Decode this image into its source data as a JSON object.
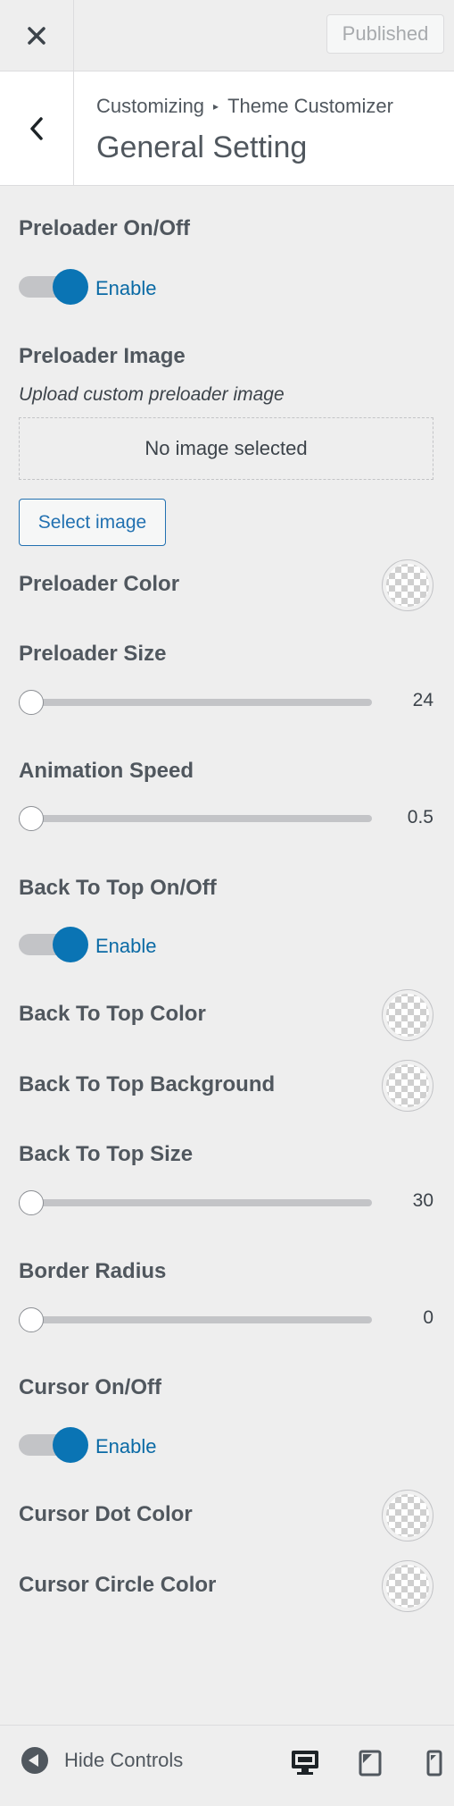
{
  "topbar": {
    "close_icon": "close-icon",
    "publish_label": "Published"
  },
  "header": {
    "breadcrumb_root": "Customizing",
    "breadcrumb_separator": "▸",
    "breadcrumb_leaf": "Theme Customizer",
    "title": "General Setting"
  },
  "preloader_toggle": {
    "label": "Preloader On/Off",
    "state_label": "Enable",
    "enabled": true
  },
  "preloader_image": {
    "label": "Preloader Image",
    "description": "Upload custom preloader image",
    "empty_text": "No image selected",
    "select_label": "Select image"
  },
  "preloader_color": {
    "label": "Preloader Color"
  },
  "preloader_size": {
    "label": "Preloader Size",
    "value": "24"
  },
  "animation_speed": {
    "label": "Animation Speed",
    "value": "0.5"
  },
  "back_to_top_toggle": {
    "label": "Back To Top On/Off",
    "state_label": "Enable",
    "enabled": true
  },
  "back_to_top_color": {
    "label": "Back To Top Color"
  },
  "back_to_top_background": {
    "label": "Back To Top Background"
  },
  "back_to_top_size": {
    "label": "Back To Top Size",
    "value": "30"
  },
  "border_radius": {
    "label": "Border Radius",
    "value": "0"
  },
  "cursor_toggle": {
    "label": "Cursor On/Off",
    "state_label": "Enable",
    "enabled": true
  },
  "cursor_dot_color": {
    "label": "Cursor Dot Color"
  },
  "cursor_circle_color": {
    "label": "Cursor Circle Color"
  },
  "footer": {
    "hide_controls_label": "Hide Controls",
    "devices": [
      "desktop",
      "tablet",
      "mobile"
    ],
    "active_device": "desktop"
  },
  "colors": {
    "accent": "#0a74b4",
    "link": "#2271b1"
  }
}
